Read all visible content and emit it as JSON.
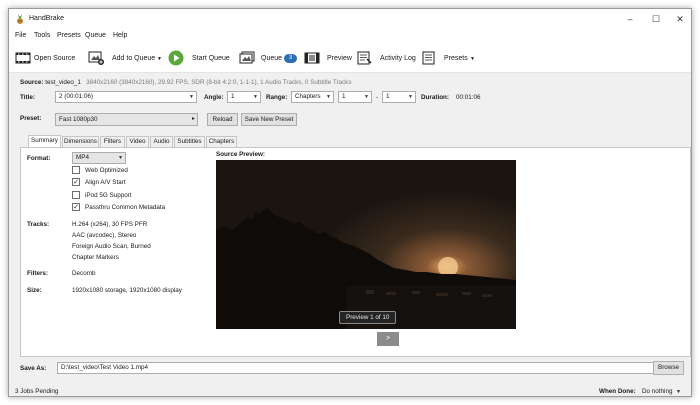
{
  "window": {
    "title": "HandBrake"
  },
  "menu": [
    "File",
    "Tools",
    "Presets",
    "Queue",
    "Help"
  ],
  "toolbar": {
    "open_source": "Open Source",
    "add_to_queue": "Add to Queue",
    "start_queue": "Start Queue",
    "queue": "Queue",
    "queue_count": "3",
    "preview": "Preview",
    "activity_log": "Activity Log",
    "presets": "Presets"
  },
  "source": {
    "label": "Source:",
    "name": "test_video_1",
    "info": "3840x2160 (3840x2160), 29.92 FPS, SDR (8-bit 4:2:0, 1-1-1), 1 Audio Tracks, 0 Subtitle Tracks"
  },
  "title_row": {
    "title_label": "Title:",
    "title_value": "2 (00:01:06)",
    "angle_label": "Angle:",
    "angle_value": "1",
    "range_label": "Range:",
    "range_value": "Chapters",
    "range_start": "1",
    "range_sep": "-",
    "range_end": "1",
    "duration_label": "Duration:",
    "duration_value": "00:01:06"
  },
  "preset": {
    "label": "Preset:",
    "value": "Fast 1080p30",
    "reload": "Reload",
    "save_new": "Save New Preset"
  },
  "tabs": [
    "Summary",
    "Dimensions",
    "Filters",
    "Video",
    "Audio",
    "Subtitles",
    "Chapters"
  ],
  "summary": {
    "format_label": "Format:",
    "format_value": "MP4",
    "options": [
      {
        "label": "Web Optimized",
        "checked": false
      },
      {
        "label": "Align A/V Start",
        "checked": true
      },
      {
        "label": "iPod 5G Support",
        "checked": false
      },
      {
        "label": "Passthru Common Metadata",
        "checked": true
      }
    ],
    "tracks_label": "Tracks:",
    "tracks": [
      "H.264 (x264), 30 FPS PFR",
      "AAC (avcodec), Stereo",
      "Foreign Audio Scan, Burned",
      "Chapter Markers"
    ],
    "filters_label": "Filters:",
    "filters_value": "Decomb",
    "size_label": "Size:",
    "size_value": "1920x1080 storage, 1920x1080 display",
    "source_preview_label": "Source Preview:",
    "preview_counter": "Preview 1 of 10",
    "next_label": ">"
  },
  "save_as": {
    "label": "Save As:",
    "value": "D:\\test_video\\Test Video 1.mp4",
    "browse": "Browse"
  },
  "status": {
    "jobs_pending": "3 Jobs Pending",
    "when_done_label": "When Done:",
    "when_done_value": "Do nothing"
  }
}
